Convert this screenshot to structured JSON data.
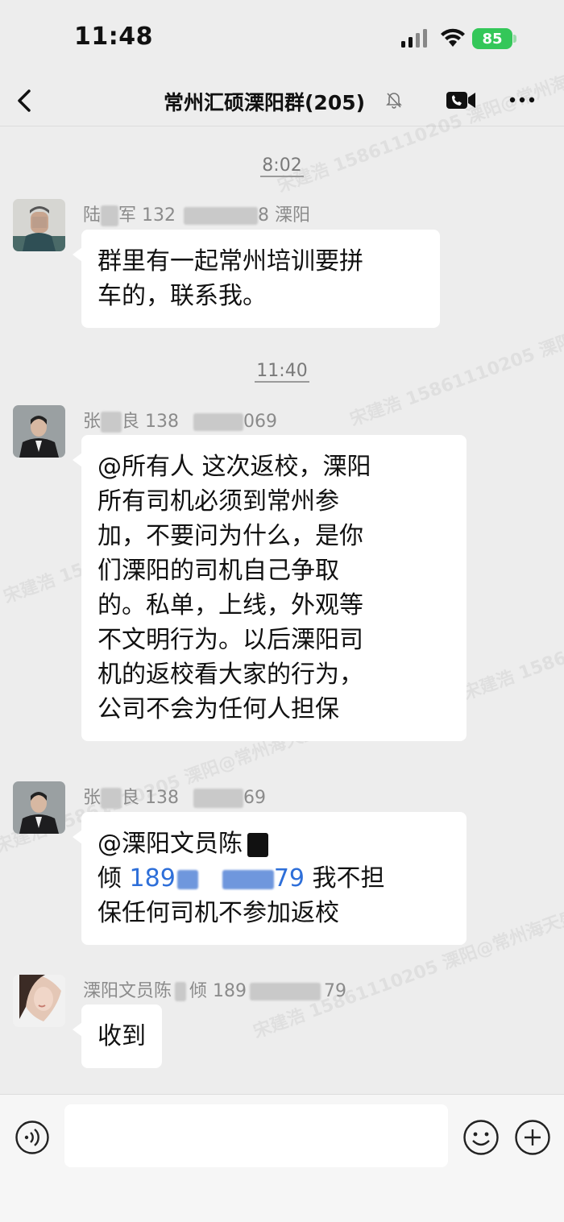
{
  "status_bar": {
    "time": "11:48",
    "battery": "85"
  },
  "nav": {
    "title": "常州汇硕溧阳群(205)"
  },
  "watermark": "宋建浩 15861110205 溧阳@常州海天盛宴联盟",
  "messages": [
    {
      "timestamp": "8:02",
      "sender_a": "陆",
      "sender_b": "军 132",
      "sender_c": "8 溧阳",
      "lines": [
        "群里有一起常州培训要拼",
        "车的，联系我。"
      ]
    },
    {
      "timestamp": "11:40",
      "sender_a": "张",
      "sender_b": "良 138",
      "sender_c": "069",
      "lines": [
        "@所有人 这次返校，溧阳",
        "所有司机必须到常州参",
        "加，不要问为什么，是你",
        "们溧阳的司机自己争取",
        "的。私单，上线，外观等",
        "不文明行为。以后溧阳司",
        "机的返校看大家的行为，",
        "公司不会为任何人担保"
      ]
    },
    {
      "sender_a": "张",
      "sender_b": "良 138",
      "sender_c": "69",
      "line1": "@溧阳文员陈",
      "line2_prefix": "倾 ",
      "phone_a": "189",
      "phone_b": "79",
      "line2_suffix": " 我不担",
      "line3": "保任何司机不参加返校"
    },
    {
      "sender_a": "溧阳文员陈",
      "sender_b": "倾 189",
      "sender_c": "79",
      "text": "收到"
    }
  ],
  "input": {
    "placeholder": ""
  }
}
